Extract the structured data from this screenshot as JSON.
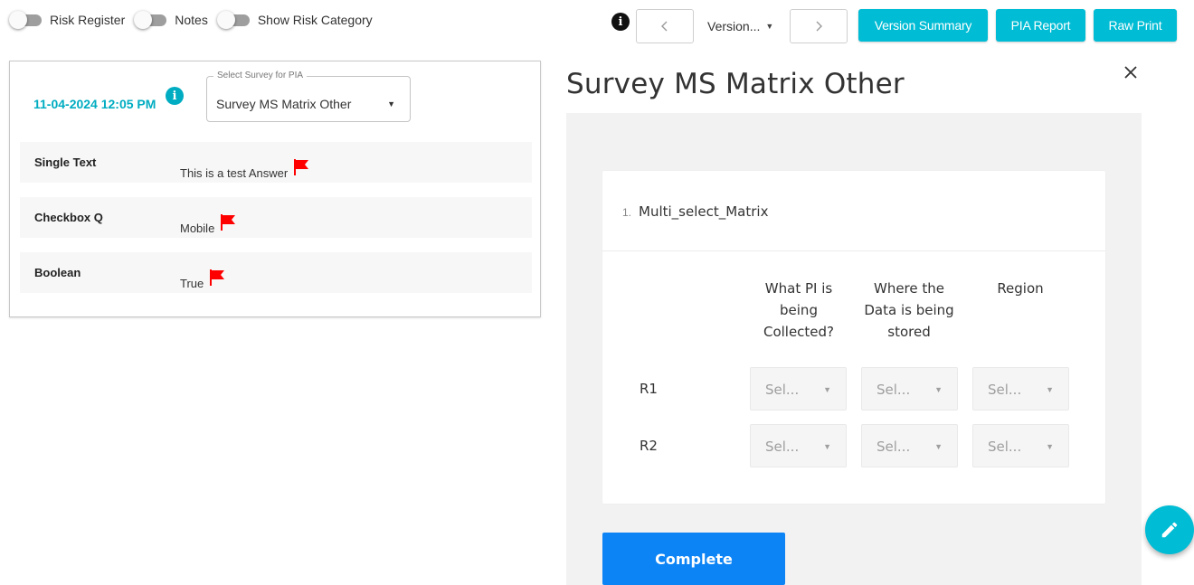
{
  "toggles": [
    {
      "label": "Risk Register",
      "on": false
    },
    {
      "label": "Notes",
      "on": false
    },
    {
      "label": "Show Risk Category",
      "on": false
    }
  ],
  "toolbar": {
    "prev_icon": "chevron-left-icon",
    "next_icon": "chevron-right-icon",
    "version_label": "Version...",
    "version_summary_label": "Version Summary",
    "pia_report_label": "PIA Report",
    "raw_print_label": "Raw Print",
    "accent_color": "#00bcd4"
  },
  "left_panel": {
    "timestamp": "11-04-2024 12:05 PM",
    "survey_select": {
      "label": "Select Survey for PIA",
      "value": "Survey MS Matrix Other"
    },
    "rows": [
      {
        "question": "Single Text",
        "answer": "This is a test Answer",
        "flag_color": "#ff0000"
      },
      {
        "question": "Checkbox Q",
        "answer": "Mobile",
        "flag_color": "#ff0000"
      },
      {
        "question": "Boolean",
        "answer": "True",
        "flag_color": "#ff0000"
      }
    ]
  },
  "survey": {
    "title": "Survey MS Matrix Other",
    "question_number": "1.",
    "question_title": "Multi_select_Matrix",
    "columns": [
      "What PI is being Collected?",
      "Where the Data is being stored",
      "Region"
    ],
    "rows": [
      "R1",
      "R2"
    ],
    "cell_placeholder": "Sel...",
    "complete_label": "Complete",
    "complete_color": "#0d84f5"
  },
  "fab": {
    "icon": "pencil-icon"
  }
}
